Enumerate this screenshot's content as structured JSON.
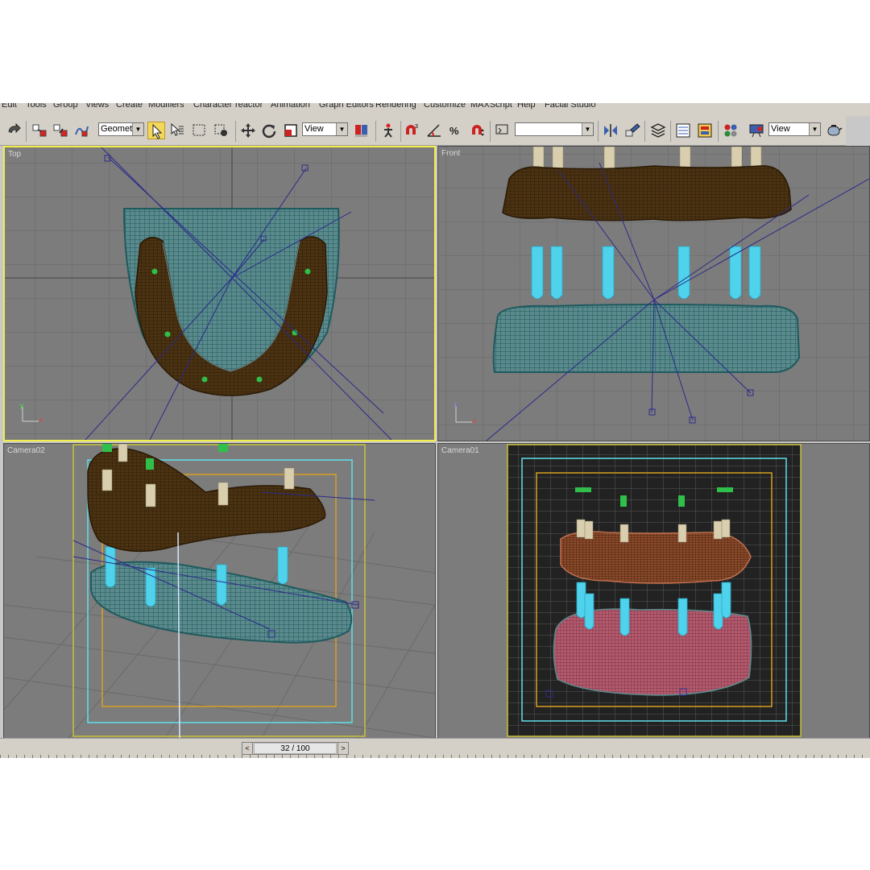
{
  "menu": [
    "Edit",
    "Tools",
    "Group",
    "Views",
    "Create",
    "Modifiers",
    "Character",
    "reactor",
    "Animation",
    "Graph Editors",
    "Rendering",
    "Customize",
    "MAXScript",
    "Help",
    "Facial Studio"
  ],
  "toolbar": {
    "selection_filter": "Geometry",
    "ref_coord_1": "View",
    "named_selection": "",
    "ref_coord_2": "View",
    "icons": [
      "undo-icon",
      "select-link-icon",
      "unlink-icon",
      "bind-space-warp-icon",
      "select-object-icon",
      "select-by-name-icon",
      "rect-selection-icon",
      "window-crossing-icon",
      "move-icon",
      "rotate-icon",
      "scale-icon",
      "pivot-icon",
      "manipulate-icon",
      "snap-3d-icon",
      "angle-snap-icon",
      "percent-snap-icon",
      "spinner-snap-icon",
      "edit-named-sel-icon",
      "mirror-icon",
      "align-icon",
      "layer-manager-icon",
      "curve-editor-icon",
      "schematic-view-icon",
      "material-editor-icon",
      "render-scene-icon",
      "quick-render-icon"
    ]
  },
  "viewports": {
    "top": {
      "label": "Top"
    },
    "front": {
      "label": "Front"
    },
    "camera02": {
      "label": "Camera02"
    },
    "camera01": {
      "label": "Camera01"
    }
  },
  "axis": {
    "x": "x",
    "y": "y",
    "z": "z"
  },
  "timeline": {
    "frame": "32 / 100",
    "prev": "<",
    "next": ">"
  },
  "colors": {
    "viewport_bg": "#7c7c7c",
    "active_border": "#f2ee4a",
    "gum_mesh": "#1f5a5e",
    "teeth_mesh": "#4a3212",
    "implant": "#4fd2ec",
    "abutment": "#d9cfae",
    "camera_line": "#2b2a8a"
  }
}
